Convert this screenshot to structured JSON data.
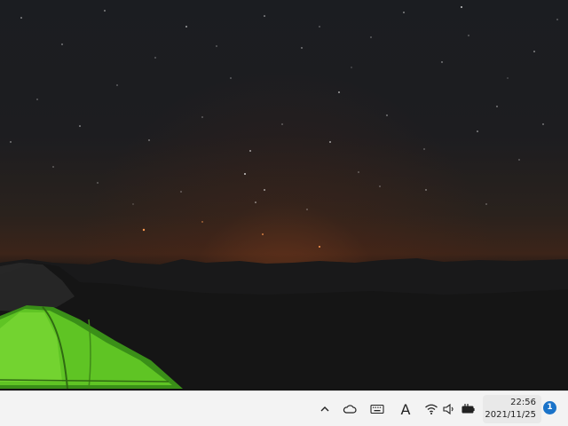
{
  "taskbar": {
    "tray_icons": [
      {
        "name": "chevron-up-icon"
      },
      {
        "name": "onedrive-cloud-icon"
      },
      {
        "name": "keyboard-icon"
      },
      {
        "name": "input-method-icon",
        "glyph": "A"
      },
      {
        "name": "wifi-icon"
      },
      {
        "name": "volume-icon"
      },
      {
        "name": "battery-icon"
      }
    ],
    "clock": {
      "time": "22:56",
      "date": "2021/11/25"
    },
    "notifications": {
      "count": "1"
    },
    "accent_color": "#1a73c9",
    "background_color": "#f3f3f3"
  }
}
